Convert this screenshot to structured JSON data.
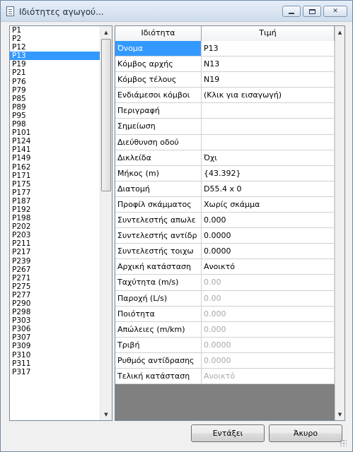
{
  "window": {
    "title": "Ιδιότητες αγωγού...",
    "icon": "document-icon"
  },
  "pipe_list": {
    "selected": "P13",
    "items": [
      "P1",
      "P2",
      "P12",
      "P13",
      "P19",
      "P21",
      "P76",
      "P79",
      "P85",
      "P89",
      "P95",
      "P98",
      "P101",
      "P124",
      "P141",
      "P149",
      "P162",
      "P171",
      "P175",
      "P177",
      "P187",
      "P192",
      "P198",
      "P202",
      "P203",
      "P211",
      "P217",
      "P239",
      "P267",
      "P271",
      "P275",
      "P277",
      "P290",
      "P298",
      "P303",
      "P306",
      "P307",
      "P309",
      "P310",
      "P311",
      "P317"
    ]
  },
  "grid": {
    "header_property": "Ιδιότητα",
    "header_value": "Τιμή",
    "rows": [
      {
        "name": "Όνομα",
        "value": "P13",
        "selected": true,
        "disabled": false
      },
      {
        "name": "Κόμβος αρχής",
        "value": "N13",
        "disabled": false
      },
      {
        "name": "Κόμβος τέλους",
        "value": "N19",
        "disabled": false
      },
      {
        "name": "Ενδιάμεσοι κόμβοι",
        "value": "(Κλικ για εισαγωγή)",
        "disabled": false
      },
      {
        "name": "Περιγραφή",
        "value": "",
        "disabled": false
      },
      {
        "name": "Σημείωση",
        "value": "",
        "disabled": false
      },
      {
        "name": "Διεύθυνση οδού",
        "value": "",
        "disabled": false
      },
      {
        "name": "Δικλείδα",
        "value": "Όχι",
        "disabled": false
      },
      {
        "name": "Μήκος (m)",
        "value": "{43.392}",
        "disabled": false
      },
      {
        "name": "Διατομή",
        "value": "D55.4 x 0",
        "disabled": false
      },
      {
        "name": "Προφίλ σκάμματος",
        "value": "Χωρίς σκάμμα",
        "disabled": false
      },
      {
        "name": "Συντελεστής απωλε",
        "value": "0.000",
        "disabled": false
      },
      {
        "name": "Συντελεστής αντίδρ",
        "value": "0.0000",
        "disabled": false
      },
      {
        "name": "Συντελεστής τοιχω",
        "value": "0.0000",
        "disabled": false
      },
      {
        "name": "Αρχική κατάσταση",
        "value": "Ανοικτό",
        "disabled": false
      },
      {
        "name": "Ταχύτητα (m/s)",
        "value": "0.00",
        "disabled": true
      },
      {
        "name": "Παροχή (L/s)",
        "value": "0.00",
        "disabled": true
      },
      {
        "name": "Ποιότητα",
        "value": "0.000",
        "disabled": true
      },
      {
        "name": "Απώλειες (m/km)",
        "value": "0.000",
        "disabled": true
      },
      {
        "name": "Τριβή",
        "value": "0.0000",
        "disabled": true
      },
      {
        "name": "Ρυθμός αντίδρασης",
        "value": "0.0000",
        "disabled": true
      },
      {
        "name": "Τελική κατάσταση",
        "value": "Ανοικτό",
        "disabled": true
      }
    ]
  },
  "buttons": {
    "ok_label": "Εντάξει",
    "cancel_label": "Άκυρο"
  }
}
